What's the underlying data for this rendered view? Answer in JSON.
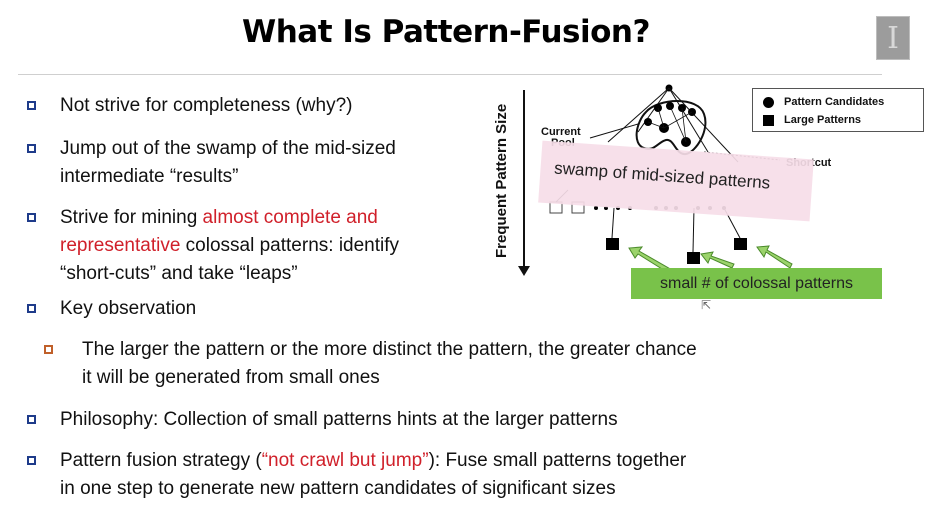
{
  "slide": {
    "title": "What Is Pattern-Fusion?",
    "logo_letter": "I"
  },
  "bullets": [
    {
      "text": "Not strive for completeness (why?)"
    },
    {
      "text_line1": "Jump out of the swamp of the mid-sized",
      "text_line2": "intermediate “results”"
    },
    {
      "pre": "Strive for mining ",
      "highlight1": "almost complete and",
      "highlight2": "representative",
      "post1": " colossal patterns: identify",
      "line3": "“short-cuts” and take “leaps”"
    },
    {
      "text": "Key observation"
    },
    {
      "line1": "The larger the pattern or the more distinct the pattern, the greater chance",
      "line2": "it will be generated from small ones"
    },
    {
      "text": "Philosophy: Collection of small patterns hints at the larger patterns"
    },
    {
      "pre": "Pattern fusion strategy (",
      "highlight": "“not crawl but jump”",
      "post": "): Fuse small patterns together",
      "line2": "in one step to generate new pattern candidates of significant sizes"
    }
  ],
  "diagram": {
    "y_axis_label": "Frequent Pattern Size",
    "current_pool_label_line1": "Current",
    "current_pool_label_line2": "Pool",
    "shortcut_label": "Shortcut",
    "legend": {
      "candidates": "Pattern Candidates",
      "large": "Large Patterns"
    },
    "swamp_label": "swamp of mid-sized patterns",
    "colossal_label": "small # of colossal patterns"
  },
  "colors": {
    "bullet_box": "#1e3b8a",
    "sub_bullet_box": "#c0602a",
    "highlight_red": "#d0202a",
    "swamp_pink": "#f6dde8",
    "colossal_green": "#79c24a"
  }
}
